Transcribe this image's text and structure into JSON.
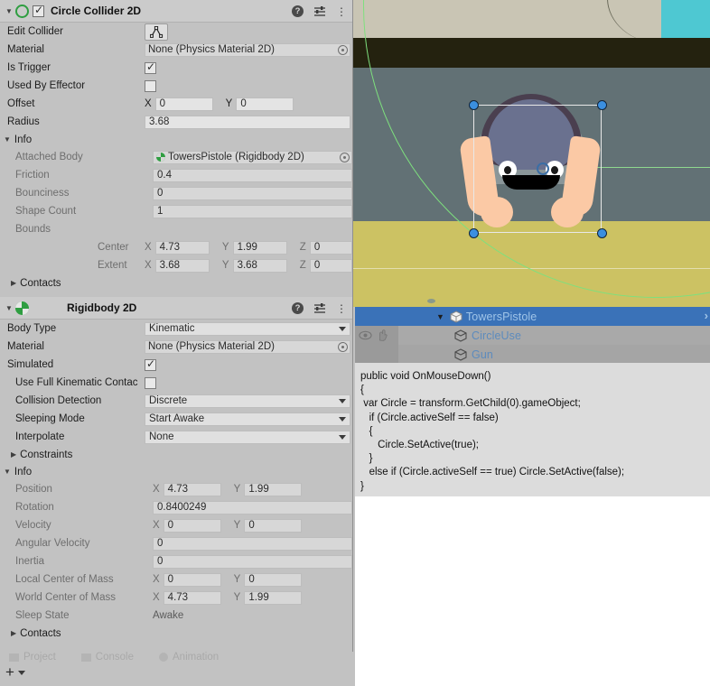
{
  "scene": {
    "name": "scene-view",
    "colors": {
      "sky_beige": "#c9c5b4",
      "dark_band": "#24220f",
      "mid_grey": "#627175",
      "ground_yellow": "#ccc263",
      "cyan": "#4ec8d2",
      "gizmo_green": "#7ee07e",
      "handle_blue": "#3b8fe0"
    }
  },
  "hierarchy": {
    "rows": [
      {
        "label": "TowersPistole",
        "selected": true,
        "indent": 1,
        "expanded": true,
        "icon": "prefab-cube-icon",
        "chevron": "›"
      },
      {
        "label": "CircleUse",
        "selected": false,
        "indent": 2,
        "expanded": false,
        "icon": "prefab-cube-icon",
        "gutter_icons": [
          "eye-icon",
          "hand-icon"
        ]
      },
      {
        "label": "Gun",
        "selected": false,
        "indent": 2,
        "expanded": false,
        "icon": "prefab-cube-icon"
      }
    ]
  },
  "code": {
    "text": "public void OnMouseDown()\n{\n var Circle = transform.GetChild(0).gameObject;\n   if (Circle.activeSelf == false)\n   {\n      Circle.SetActive(true);\n   }\n   else if (Circle.activeSelf == true) Circle.SetActive(false);\n}"
  },
  "inspector": {
    "collider": {
      "title": "Circle Collider 2D",
      "enabled_check": "✓",
      "icon": "circle-collider-2d-icon",
      "header_icons": {
        "help": "?",
        "preset": "preset-icon",
        "menu": "⋮"
      },
      "rows": {
        "edit_collider_label": "Edit Collider",
        "edit_collider_icon": "edit-collider-icon",
        "material_label": "Material",
        "material_value": "None (Physics Material 2D)",
        "is_trigger_label": "Is Trigger",
        "is_trigger_value": "✓",
        "used_by_effector_label": "Used By Effector",
        "used_by_effector_value": "",
        "offset_label": "Offset",
        "offset_x_axis": "X",
        "offset_x": "0",
        "offset_y_axis": "Y",
        "offset_y": "0",
        "radius_label": "Radius",
        "radius_value": "3.68"
      },
      "info": {
        "title": "Info",
        "attached_body_label": "Attached Body",
        "attached_body_value": "TowersPistole (Rigidbody 2D)",
        "friction_label": "Friction",
        "friction_value": "0.4",
        "bounciness_label": "Bounciness",
        "bounciness_value": "0",
        "shape_count_label": "Shape Count",
        "shape_count_value": "1",
        "bounds_label": "Bounds",
        "center_label": "Center",
        "center_x_axis": "X",
        "center_x": "4.73",
        "center_y_axis": "Y",
        "center_y": "1.99",
        "center_z_axis": "Z",
        "center_z": "0",
        "extent_label": "Extent",
        "extent_x_axis": "X",
        "extent_x": "3.68",
        "extent_y_axis": "Y",
        "extent_y": "3.68",
        "extent_z_axis": "Z",
        "extent_z": "0",
        "contacts_label": "Contacts"
      }
    },
    "rigidbody": {
      "title": "Rigidbody 2D",
      "icon": "rigidbody-2d-icon",
      "header_icons": {
        "help": "?",
        "preset": "preset-icon",
        "menu": "⋮"
      },
      "rows": {
        "body_type_label": "Body Type",
        "body_type_value": "Kinematic",
        "material_label": "Material",
        "material_value": "None (Physics Material 2D)",
        "simulated_label": "Simulated",
        "simulated_value": "✓",
        "use_full_kinematic_label": "Use Full Kinematic Contac",
        "collision_detection_label": "Collision Detection",
        "collision_detection_value": "Discrete",
        "sleeping_mode_label": "Sleeping Mode",
        "sleeping_mode_value": "Start Awake",
        "interpolate_label": "Interpolate",
        "interpolate_value": "None",
        "constraints_label": "Constraints"
      },
      "info": {
        "title": "Info",
        "position_label": "Position",
        "position_x_axis": "X",
        "position_x": "4.73",
        "position_y_axis": "Y",
        "position_y": "1.99",
        "rotation_label": "Rotation",
        "rotation_value": "0.8400249",
        "velocity_label": "Velocity",
        "velocity_x_axis": "X",
        "velocity_x": "0",
        "velocity_y_axis": "Y",
        "velocity_y": "0",
        "angular_velocity_label": "Angular Velocity",
        "angular_velocity_value": "0",
        "inertia_label": "Inertia",
        "inertia_value": "0",
        "local_com_label": "Local Center of Mass",
        "local_com_x_axis": "X",
        "local_com_x": "0",
        "local_com_y_axis": "Y",
        "local_com_y": "0",
        "world_com_label": "World Center of Mass",
        "world_com_x_axis": "X",
        "world_com_x": "4.73",
        "world_com_y_axis": "Y",
        "world_com_y": "1.99",
        "sleep_state_label": "Sleep State",
        "sleep_state_value": "Awake",
        "contacts_label": "Contacts"
      }
    }
  },
  "bottom_tabs": {
    "tabs": [
      "Project",
      "Console",
      "Animation"
    ],
    "add_label": "+"
  }
}
